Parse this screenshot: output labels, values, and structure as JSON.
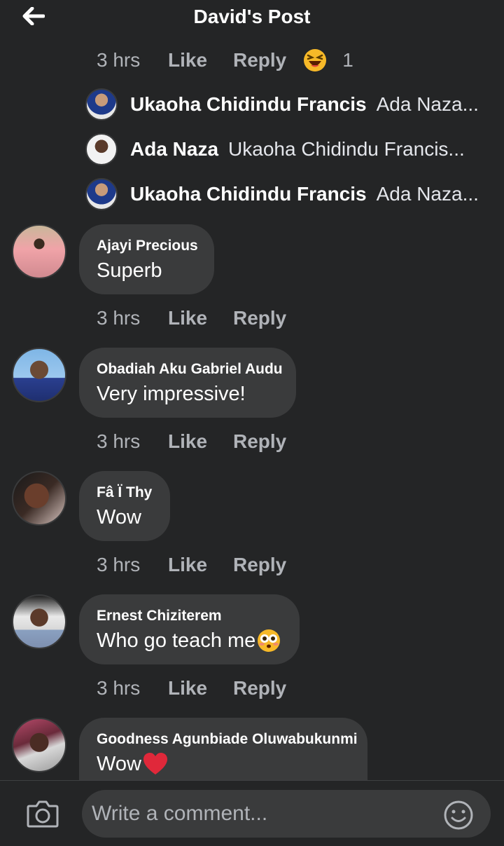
{
  "header": {
    "title": "David's Post",
    "back_icon": "back-arrow-icon"
  },
  "top_reply_meta": {
    "time": "3 hrs",
    "like": "Like",
    "reply": "Reply",
    "reaction_icon": "laughing-emoji-icon",
    "reaction_count": "1"
  },
  "replies": [
    {
      "name": "Ukaoha Chidindu Francis",
      "text": "Ada Naza..."
    },
    {
      "name": "Ada Naza",
      "text": "Ukaoha Chidindu Francis..."
    },
    {
      "name": "Ukaoha Chidindu Francis",
      "text": "Ada Naza..."
    }
  ],
  "comments": [
    {
      "author": "Ajayi Precious",
      "text": "Superb",
      "time": "3 hrs",
      "like": "Like",
      "reply": "Reply"
    },
    {
      "author": "Obadiah Aku Gabriel Audu",
      "text": "Very impressive!",
      "time": "3 hrs",
      "like": "Like",
      "reply": "Reply"
    },
    {
      "author": "Fâ Ï Thy",
      "text": "Wow",
      "time": "3 hrs",
      "like": "Like",
      "reply": "Reply"
    },
    {
      "author": "Ernest Chiziterem",
      "text": "Who go teach me",
      "emoji": "flushed-emoji-icon",
      "time": "3 hrs",
      "like": "Like",
      "reply": "Reply"
    },
    {
      "author": "Goodness Agunbiade Oluwabukunmi",
      "text": "Wow",
      "emoji": "red-heart-icon"
    }
  ],
  "composer": {
    "placeholder": "Write a comment...",
    "camera_icon": "camera-icon",
    "emoji_icon": "smiley-icon"
  },
  "colors": {
    "background": "#242526",
    "bubble": "#3a3b3c",
    "secondary_text": "#b0b3b8"
  }
}
